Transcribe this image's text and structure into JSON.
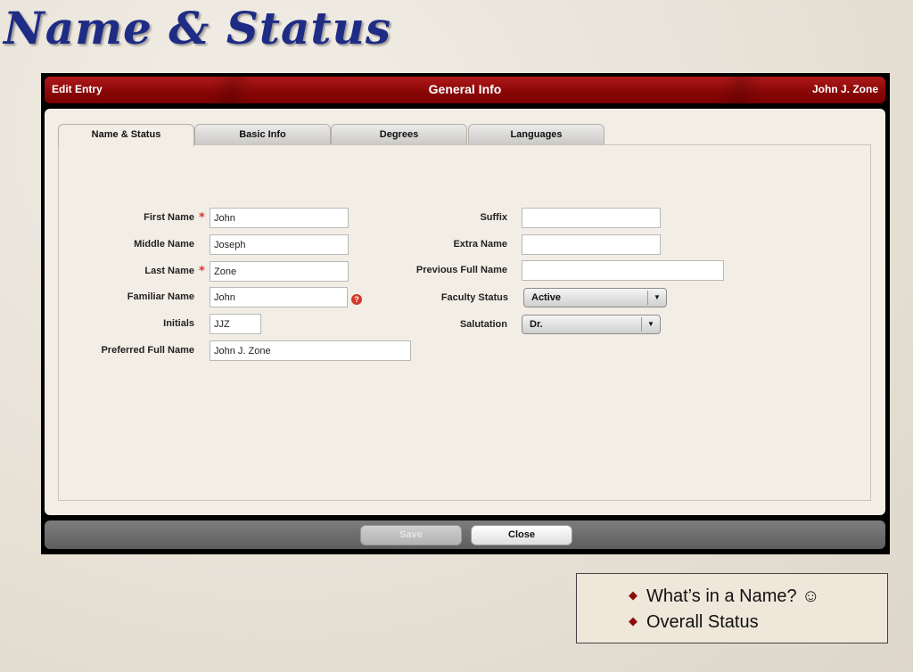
{
  "slide": {
    "title": "Name & Status"
  },
  "header": {
    "left": "Edit Entry",
    "center": "General Info",
    "right": "John J. Zone"
  },
  "tabs": [
    {
      "label": "Name & Status",
      "active": true
    },
    {
      "label": "Basic Info",
      "active": false
    },
    {
      "label": "Degrees",
      "active": false
    },
    {
      "label": "Languages",
      "active": false
    }
  ],
  "form": {
    "first_name": {
      "label": "First Name",
      "value": "John",
      "required": true
    },
    "middle_name": {
      "label": "Middle Name",
      "value": "Joseph"
    },
    "last_name": {
      "label": "Last Name",
      "value": "Zone",
      "required": true
    },
    "familiar_name": {
      "label": "Familiar Name",
      "value": "John",
      "help_icon": "?"
    },
    "initials": {
      "label": "Initials",
      "value": "JJZ"
    },
    "preferred_full_name": {
      "label": "Preferred Full Name",
      "value": "John J. Zone"
    },
    "suffix": {
      "label": "Suffix",
      "value": ""
    },
    "extra_name": {
      "label": "Extra Name",
      "value": ""
    },
    "previous_full_name": {
      "label": "Previous Full Name",
      "value": ""
    },
    "faculty_status": {
      "label": "Faculty Status",
      "value": "Active"
    },
    "salutation": {
      "label": "Salutation",
      "value": "Dr."
    },
    "required_marker": "*",
    "dropdown_arrow": "▼"
  },
  "footer": {
    "save_label": "Save",
    "close_label": "Close"
  },
  "notes": {
    "bullet": "◆",
    "items": [
      "What’s in a Name? ☺",
      "Overall Status"
    ]
  },
  "colors": {
    "header_red": "#8a0707",
    "title_blue": "#1f2c86",
    "required_red": "#e03030"
  }
}
